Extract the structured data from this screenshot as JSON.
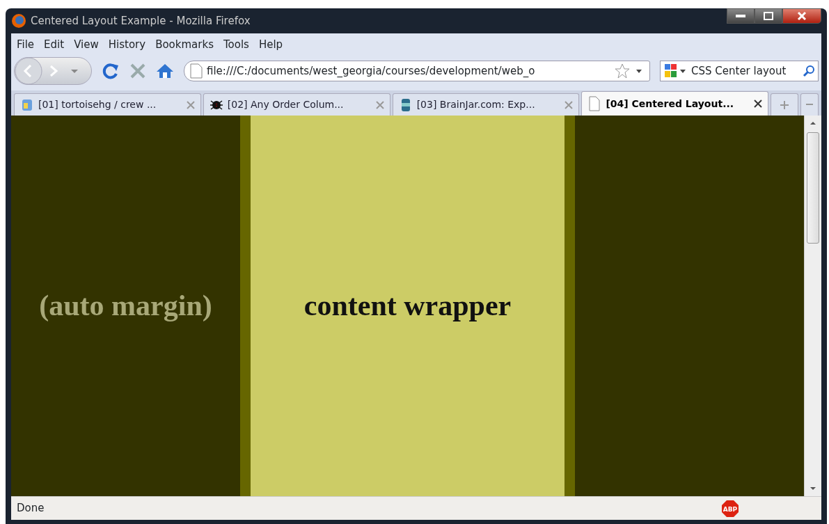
{
  "window": {
    "title": "Centered Layout Example - Mozilla Firefox"
  },
  "menu": [
    "File",
    "Edit",
    "View",
    "History",
    "Bookmarks",
    "Tools",
    "Help"
  ],
  "address_bar": {
    "value": "file:///C:/documents/west_georgia/courses/development/web_o"
  },
  "search": {
    "value": "CSS Center layout"
  },
  "tabs": [
    {
      "label": "[01] tortoisehg / crew ...",
      "selected": false,
      "kind": "jar"
    },
    {
      "label": "[02] Any Order Colum...",
      "selected": false,
      "kind": "bug"
    },
    {
      "label": "[03] BrainJar.com: Exp...",
      "selected": false,
      "kind": "can"
    },
    {
      "label": "[04] Centered Layout...",
      "selected": true,
      "kind": "page"
    }
  ],
  "page": {
    "margin_left": "(auto margin)",
    "wrapper": "content wrapper"
  },
  "status_bar": {
    "text": "Done",
    "addon_badge": "ABP"
  }
}
